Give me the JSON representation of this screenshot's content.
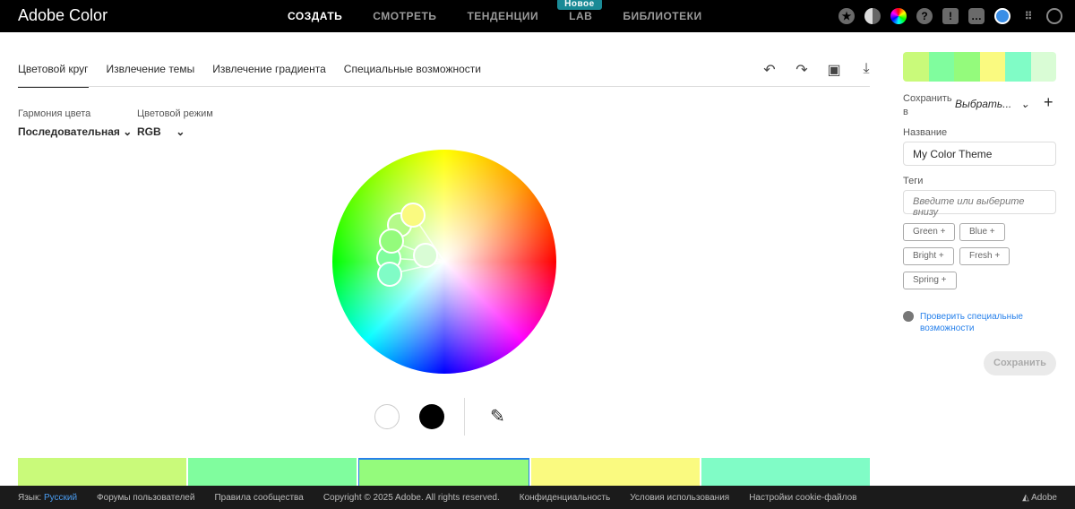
{
  "header": {
    "brand": "Adobe Color",
    "nav": [
      "СОЗДАТЬ",
      "СМОТРЕТЬ",
      "ТЕНДЕНЦИИ",
      "LAB",
      "БИБЛИОТЕКИ"
    ],
    "new_badge": "Новое"
  },
  "tabs": [
    "Цветовой круг",
    "Извлечение темы",
    "Извлечение градиента",
    "Специальные возможности"
  ],
  "controls": {
    "harmony_label": "Гармония цвета",
    "harmony_value": "Последовательная",
    "mode_label": "Цветовой режим",
    "mode_value": "RGB"
  },
  "swatches": [
    "#c9fa7a",
    "#80fd9e",
    "#94fb7c",
    "#fafa80",
    "#80fcc6"
  ],
  "panel": {
    "palette": [
      "#c9fa7a",
      "#80fd9e",
      "#94fb7c",
      "#fafa80",
      "#80fcc6",
      "#d9fcd5"
    ],
    "save_to": "Сохранить в",
    "library": "Выбрать...",
    "name_label": "Название",
    "name_value": "My Color Theme",
    "tags_label": "Теги",
    "tags_placeholder": "Введите или выберите внизу",
    "tags": [
      "Green",
      "Blue",
      "Bright",
      "Fresh",
      "Spring"
    ],
    "accessibility_link": "Проверить специальные возможности",
    "save": "Сохранить"
  },
  "footer": {
    "lang_label": "Язык:",
    "lang": "Русский",
    "links": [
      "Форумы пользователей",
      "Правила сообщества",
      "Copyright © 2025 Adobe. All rights reserved.",
      "Конфиденциальность",
      "Условия использования",
      "Настройки cookie-файлов"
    ],
    "adobe": "Adobe"
  }
}
